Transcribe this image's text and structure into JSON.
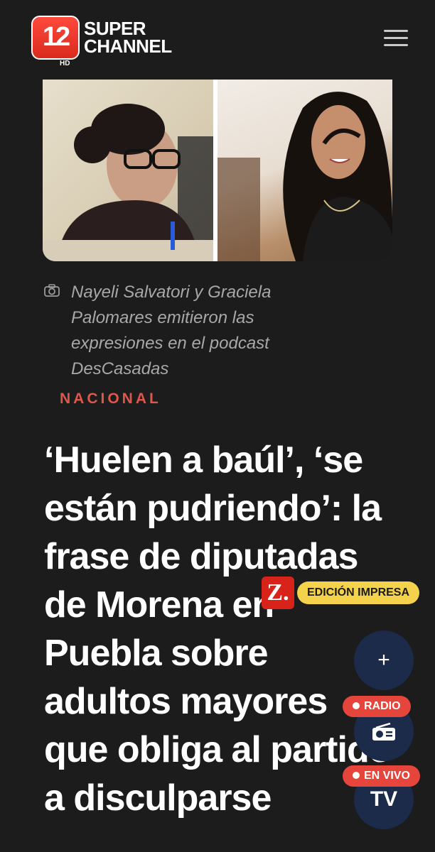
{
  "header": {
    "logo_number": "12",
    "logo_hd": "HD",
    "logo_line1": "SUPER",
    "logo_line2": "CHANNEL",
    "menu_icon": "hamburger-icon"
  },
  "hero": {
    "caption": "Nayeli Salvatori y Graciela Palomares emitieron las expresiones en el podcast DesCasadas",
    "caption_icon": "camera-icon"
  },
  "article": {
    "section": "NACIONAL",
    "headline": "‘Huelen a baúl’, ‘se están pudriendo’: la frase de diputadas de Morena en Puebla sobre adultos mayores que obliga al partido a disculparse"
  },
  "overlay": {
    "edicion_logo": "Z.",
    "edicion_label": "EDICIÓN IMPRESA",
    "fab_plus": "+",
    "radio_label": "RADIO",
    "envivo_label": "EN VIVO",
    "tv_label": "TV"
  },
  "colors": {
    "background": "#1c1c1c",
    "accent_red": "#e5453b",
    "fab_navy": "#1c2b4a",
    "edicion_yellow": "#f5d24c"
  }
}
